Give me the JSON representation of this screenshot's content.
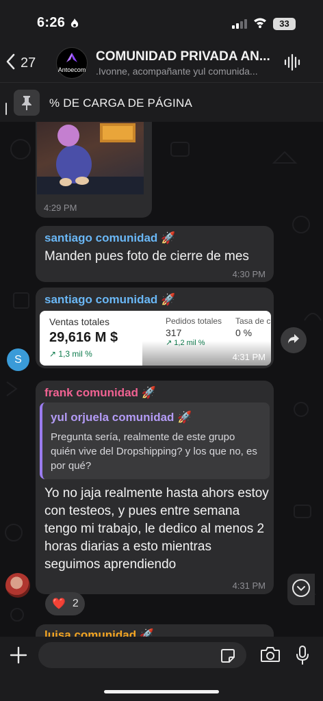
{
  "status_bar": {
    "time": "6:26",
    "battery": "33"
  },
  "header": {
    "back_count": "27",
    "avatar_label": "Antoecom",
    "title": "COMUNIDAD PRIVADA AN...",
    "subtitle": ".Ivonne, acompañante yul comunida..."
  },
  "pinned": {
    "text": "% DE CARGA DE PÁGINA"
  },
  "messages": [
    {
      "type": "media",
      "time": "4:29 PM"
    },
    {
      "sender": "santiago comunidad 🚀",
      "text": "Manden pues foto de cierre de mes",
      "time": "4:30 PM",
      "sender_color": "#6ab7f5"
    },
    {
      "sender": "santiago comunidad 🚀",
      "time": "4:31 PM",
      "sender_color": "#6ab7f5",
      "card": {
        "label1": "Ventas totales",
        "value1": "29,616 M $",
        "delta1": "↗ 1,3 mil %",
        "label2": "Pedidos totales",
        "value2": "317",
        "delta2": "↗ 1,2 mil %",
        "label3": "Tasa de c",
        "value3": "0 %"
      }
    },
    {
      "sender": "frank comunidad 🚀",
      "time": "4:31 PM",
      "sender_color": "#f06292",
      "reply": {
        "author": "yul orjuela comunidad 🚀",
        "text": "Pregunta sería, realmente de este grupo quién vive del Dropshipping? y los que no, es por qué?"
      },
      "text": "Yo no jaja realmente hasta ahors estoy con testeos, y pues entre semana tengo mi trabajo, le dedico al menos 2 horas diarias a esto mientras seguimos aprendiendo",
      "reaction": {
        "emoji": "❤️",
        "count": "2"
      }
    },
    {
      "sender": "luisa comunidad 🚀",
      "sender_color": "#f5a623"
    }
  ],
  "avatar_s": "S",
  "input": {
    "placeholder": ""
  }
}
